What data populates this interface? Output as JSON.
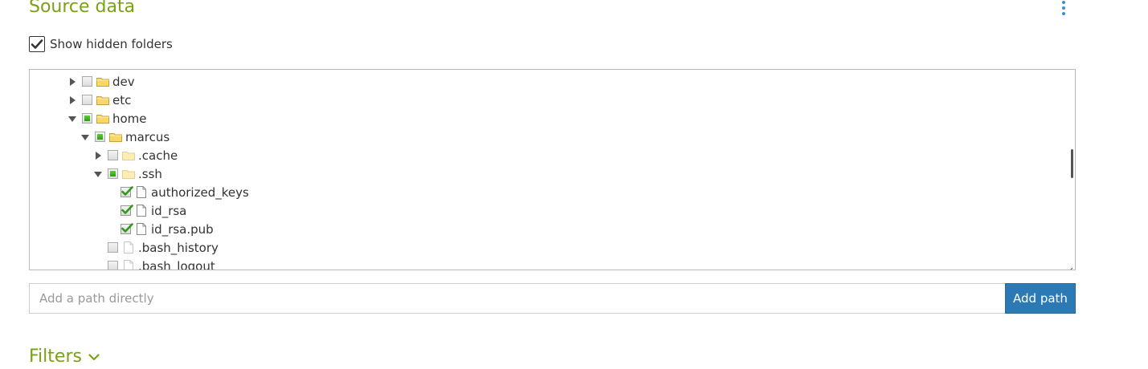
{
  "header": {
    "title": "Source data",
    "menu_icon": "kebab-menu-icon"
  },
  "options": {
    "show_hidden_label": "Show hidden folders",
    "show_hidden_checked": true
  },
  "tree": {
    "rows": [
      {
        "label": "dev",
        "type": "folder",
        "expanded": false,
        "state": "unchecked"
      },
      {
        "label": "etc",
        "type": "folder",
        "expanded": false,
        "state": "unchecked"
      },
      {
        "label": "home",
        "type": "folder",
        "expanded": true,
        "state": "partial"
      },
      {
        "label": "marcus",
        "type": "folder",
        "expanded": true,
        "state": "partial"
      },
      {
        "label": ".cache",
        "type": "folder",
        "expanded": false,
        "state": "unchecked",
        "hidden": true
      },
      {
        "label": ".ssh",
        "type": "folder",
        "expanded": true,
        "state": "partial",
        "hidden": true
      },
      {
        "label": "authorized_keys",
        "type": "file",
        "state": "checked"
      },
      {
        "label": "id_rsa",
        "type": "file",
        "state": "checked"
      },
      {
        "label": "id_rsa.pub",
        "type": "file",
        "state": "checked"
      },
      {
        "label": ".bash_history",
        "type": "file",
        "state": "unchecked",
        "hidden": true
      },
      {
        "label": ".bash_logout",
        "type": "file",
        "state": "unchecked",
        "hidden": true
      }
    ]
  },
  "path": {
    "placeholder": "Add a path directly",
    "value": "",
    "button_label": "Add path"
  },
  "filters": {
    "title": "Filters",
    "icon": "chevron-down-icon"
  },
  "colors": {
    "accent_green": "#7aa116",
    "button_blue": "#2b7ab5",
    "check_green": "#2f9a16"
  }
}
